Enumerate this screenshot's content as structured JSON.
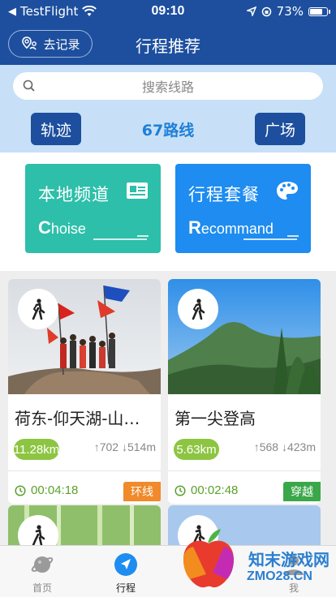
{
  "status_bar": {
    "carrier": "TestFlight",
    "time": "09:10",
    "battery": "73%",
    "battery_level": 0.73
  },
  "nav": {
    "back_label": "去记录",
    "title": "行程推荐"
  },
  "search": {
    "placeholder": "搜索线路"
  },
  "header": {
    "left_button": "轨迹",
    "route_count": "67路线",
    "right_button": "广场"
  },
  "categories": [
    {
      "title": "本地频道",
      "subtitle_initial": "C",
      "subtitle_rest": "hoise",
      "color": "#2dbfa9",
      "icon": "id-card-icon"
    },
    {
      "title": "行程套餐",
      "subtitle_initial": "R",
      "subtitle_rest": "ecommand",
      "color": "#1e8cf0",
      "icon": "palette-icon"
    }
  ],
  "routes": [
    {
      "name": "荷东-仰天湖-山…",
      "distance": "11.28km",
      "ascent": "702",
      "descent": "514m",
      "time": "00:04:18",
      "tag": "环线",
      "tag_color": "#f08a2a"
    },
    {
      "name": "第一尖登高",
      "distance": "5.63km",
      "ascent": "568",
      "descent": "423m",
      "time": "00:02:48",
      "tag": "穿越",
      "tag_color": "#3aa74a"
    }
  ],
  "tabs": [
    {
      "label": "首页",
      "icon": "planet-icon",
      "active": false
    },
    {
      "label": "行程",
      "icon": "navigate-icon",
      "active": true
    },
    {
      "label": "我",
      "icon": "user-icon",
      "active": false
    }
  ],
  "watermark": {
    "line1": "知末游戏网",
    "line2": "ZMO28.CN"
  }
}
